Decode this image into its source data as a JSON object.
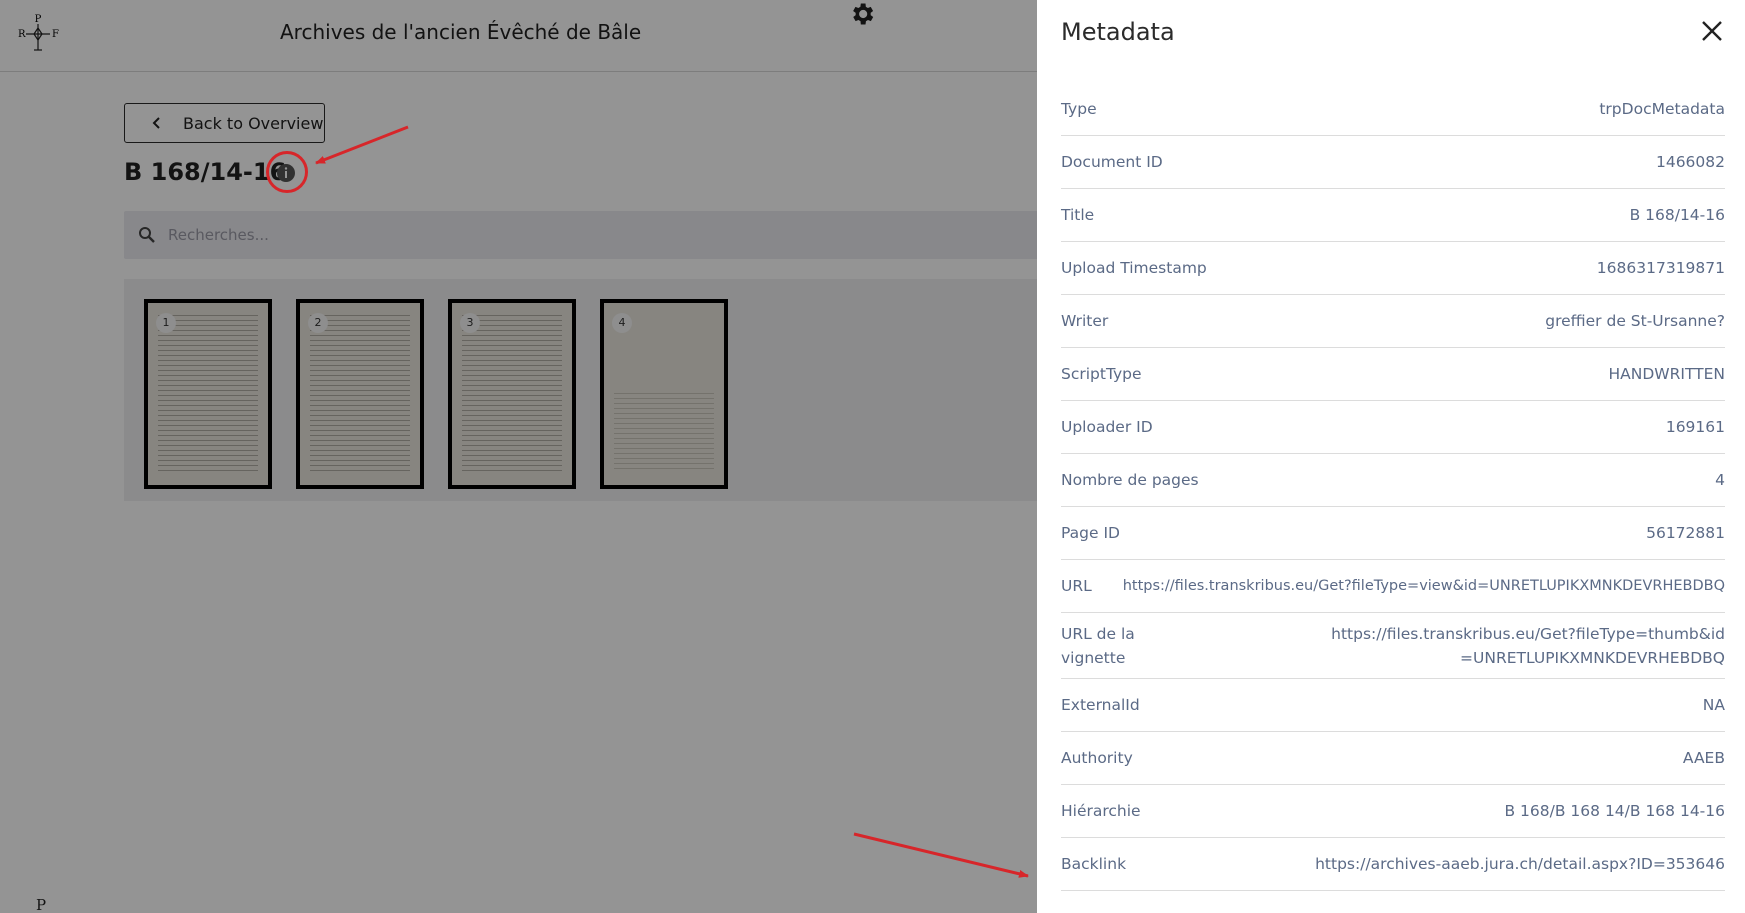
{
  "header": {
    "logo_letters": {
      "top": "P",
      "left": "R",
      "right": "F"
    },
    "title": "Archives de l'ancien Évêché de Bâle"
  },
  "document": {
    "back_label": "Back to Overview",
    "title": "B 168/14-16",
    "search_placeholder": "Recherches..."
  },
  "thumbnails": [
    {
      "number": "1"
    },
    {
      "number": "2"
    },
    {
      "number": "3"
    },
    {
      "number": "4"
    }
  ],
  "footer": {
    "logo_letter": "P"
  },
  "panel": {
    "title": "Metadata",
    "rows": [
      {
        "key": "Type",
        "value": "trpDocMetadata"
      },
      {
        "key": "Document ID",
        "value": "1466082"
      },
      {
        "key": "Title",
        "value": "B 168/14-16"
      },
      {
        "key": "Upload Timestamp",
        "value": "1686317319871"
      },
      {
        "key": "Writer",
        "value": "greffier de St-Ursanne?"
      },
      {
        "key": "ScriptType",
        "value": "HANDWRITTEN"
      },
      {
        "key": "Uploader ID",
        "value": "169161"
      },
      {
        "key": "Nombre de pages",
        "value": "4"
      },
      {
        "key": "Page ID",
        "value": "56172881"
      },
      {
        "key": "URL",
        "value": "https://files.transkribus.eu/Get?fileType=view&id=UNRETLUPIKXMNKDEVRHEBDBQ"
      },
      {
        "key": "URL de la vignette",
        "value": "https://files.transkribus.eu/Get?fileType=thumb&id=UNRETLUPIKXMNKDEVRHEBDBQ"
      },
      {
        "key": "ExternalId",
        "value": "NA"
      },
      {
        "key": "Authority",
        "value": "AAEB"
      },
      {
        "key": "Hiérarchie",
        "value": "B 168/B 168 14/B 168 14-16"
      },
      {
        "key": "Backlink",
        "value": "https://archives-aaeb.jura.ch/detail.aspx?ID=353646"
      }
    ]
  },
  "colors": {
    "annotation": "#d7262a",
    "meta_text": "#5b6a86",
    "overlay": "rgba(0,0,0,0.42)"
  }
}
